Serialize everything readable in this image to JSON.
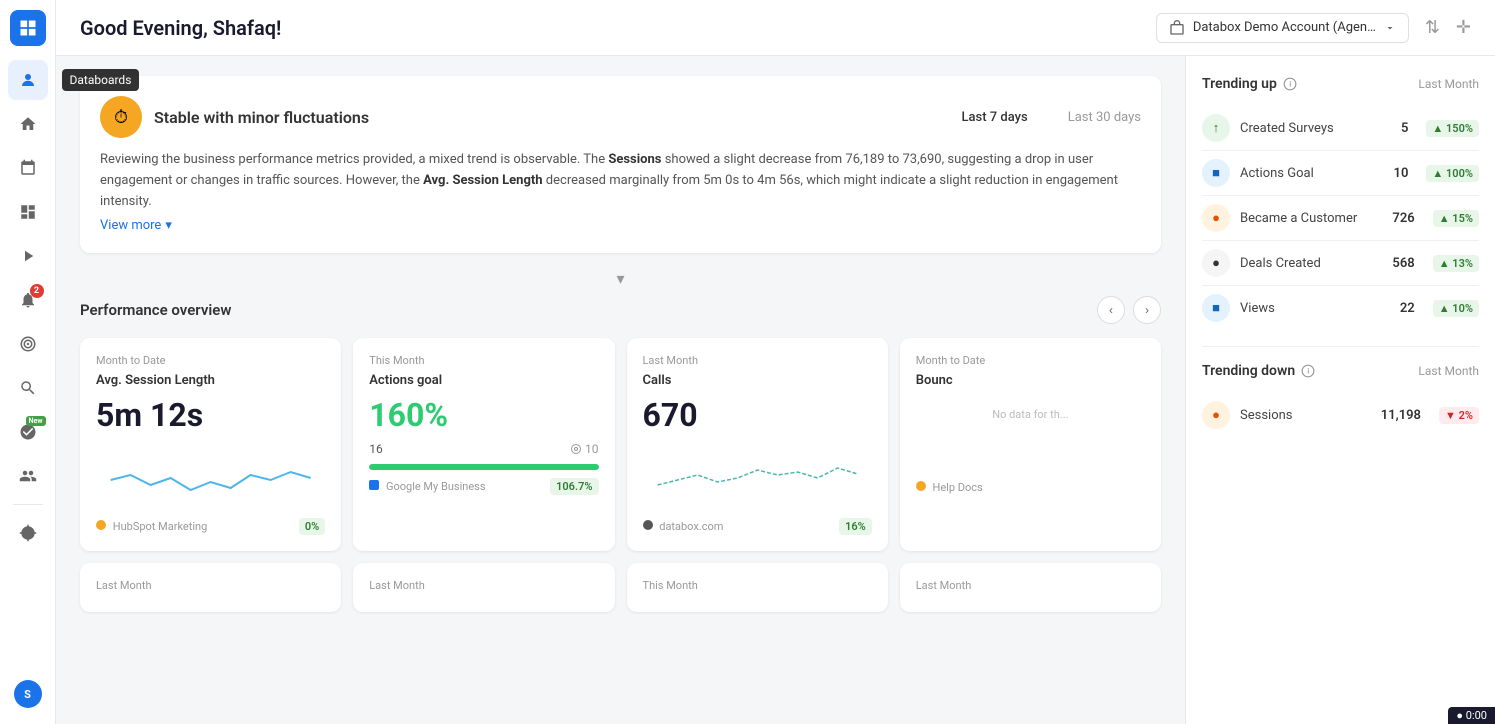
{
  "topbar": {
    "greeting": "Good Evening, Shafaq!",
    "account_label": "Databox Demo Account (Agen…",
    "account_icon": "building-icon",
    "chevron_icon": "chevron-down-icon",
    "sort_icon": "sort-icon",
    "pin_icon": "pin-icon"
  },
  "sidebar": {
    "logo_icon": "databox-logo-icon",
    "items": [
      {
        "id": "user",
        "icon": "user-icon",
        "label": "User",
        "active": true,
        "tooltip": "Databoards"
      },
      {
        "id": "home",
        "icon": "home-icon",
        "label": "Home",
        "active": false
      },
      {
        "id": "calendar",
        "icon": "calendar-icon",
        "label": "Calendar",
        "active": false
      },
      {
        "id": "databoards",
        "icon": "databoards-icon",
        "label": "Databoards",
        "active": false
      },
      {
        "id": "play",
        "icon": "play-icon",
        "label": "Play",
        "active": false
      },
      {
        "id": "alerts",
        "icon": "alerts-icon",
        "label": "Alerts",
        "active": false,
        "badge": "2"
      },
      {
        "id": "goals",
        "icon": "goals-icon",
        "label": "Goals",
        "active": false
      },
      {
        "id": "search",
        "icon": "search-icon",
        "label": "Search",
        "active": false
      },
      {
        "id": "new-feature",
        "icon": "new-feature-icon",
        "label": "New Feature",
        "active": false,
        "badge_new": "New"
      },
      {
        "id": "team",
        "icon": "team-icon",
        "label": "Team",
        "active": false
      },
      {
        "id": "settings",
        "icon": "settings-icon",
        "label": "Settings",
        "active": false
      },
      {
        "id": "profile",
        "icon": "profile-icon",
        "label": "Profile",
        "active": false
      }
    ]
  },
  "ai_summary": {
    "icon": "⏱",
    "title": "Stable with minor fluctuations",
    "period_options": [
      "Last 7 days",
      "Last 30 days"
    ],
    "active_period": "Last 7 days",
    "body_text": "Reviewing the business performance metrics provided, a mixed trend is observable. The Sessions showed a slight decrease from 76,189 to 73,690, suggesting a drop in user engagement or changes in traffic sources. However, the Avg. Session Length decreased marginally from 5m 0s to 4m 56s, which might indicate a slight reduction in engagement intensity.",
    "view_more_label": "View more"
  },
  "performance_overview": {
    "title": "Performance overview",
    "prev_icon": "chevron-left-icon",
    "next_icon": "chevron-right-icon",
    "cards": [
      {
        "period": "Month to Date",
        "title": "Avg. Session Length",
        "value": "5m 12s",
        "value_color": "dark",
        "source": "HubSpot Marketing",
        "source_badge": "0%",
        "has_sparkline": true,
        "sparkline_color": "#4db6e8"
      },
      {
        "period": "This Month",
        "title": "Actions goal",
        "value": "160%",
        "value_color": "green",
        "current": "16",
        "goal": "10",
        "progress_pct": 100,
        "source": "Google My Business",
        "source_badge": "106.7%",
        "has_sparkline": false,
        "has_progress": true
      },
      {
        "period": "Last Month",
        "title": "Calls",
        "value": "670",
        "value_color": "dark",
        "source": "databox.com",
        "source_badge": "16%",
        "has_sparkline": true,
        "sparkline_color": "#4db6ac"
      },
      {
        "period": "Month to Date",
        "title": "Bounc",
        "value": "",
        "value_color": "dark",
        "source": "Help Docs",
        "source_badge": "",
        "has_sparkline": false,
        "no_data": true,
        "no_data_text": "No data for th..."
      }
    ]
  },
  "bottom_cards": [
    {
      "period": "Last Month"
    },
    {
      "period": "Last Month"
    },
    {
      "period": "This Month"
    },
    {
      "period": "Last Month"
    }
  ],
  "trending_up": {
    "label": "Trending up",
    "period": "Last Month",
    "info_icon": "info-icon",
    "items": [
      {
        "name": "Created Surveys",
        "value": "5",
        "change": "▲ 150%",
        "icon_type": "green",
        "icon": "↑"
      },
      {
        "name": "Actions Goal",
        "value": "10",
        "change": "▲ 100%",
        "icon_type": "blue",
        "icon": "■"
      },
      {
        "name": "Became a Customer",
        "value": "726",
        "change": "▲ 15%",
        "icon_type": "orange",
        "icon": "●"
      },
      {
        "name": "Deals Created",
        "value": "568",
        "change": "▲ 13%",
        "icon_type": "dark",
        "icon": "●"
      },
      {
        "name": "Views",
        "value": "22",
        "change": "▲ 10%",
        "icon_type": "blue",
        "icon": "■"
      }
    ]
  },
  "trending_down": {
    "label": "Trending down",
    "period": "Last Month",
    "info_icon": "info-icon",
    "items": [
      {
        "name": "Sessions",
        "value": "11,198",
        "change": "▼ 2%",
        "icon_type": "orange",
        "icon": "●"
      }
    ]
  },
  "bottom_bar": {
    "text": "● 0:00"
  }
}
